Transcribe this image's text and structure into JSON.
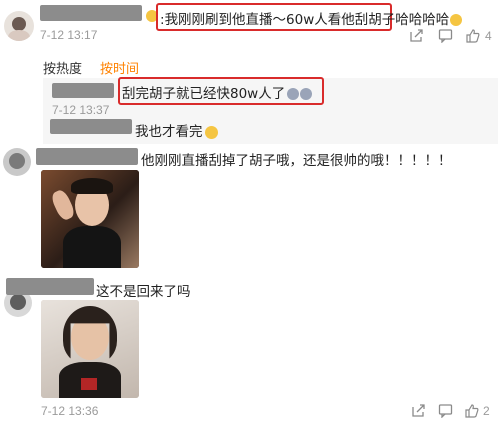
{
  "comment1": {
    "text_prefix": ":",
    "text": "我刚刚刷到他直播～60w人看他刮胡子哈哈哈哈",
    "time": "7-12 13:17",
    "like_count": "4"
  },
  "sort_tabs": {
    "hot": "按热度",
    "time": "按时间"
  },
  "reply1": {
    "text": "刮完胡子就已经快80w人了",
    "time": "7-12 13:37"
  },
  "reply2": {
    "text": "我也才看完"
  },
  "comment2": {
    "text": "他刚刚直播刮掉了胡子哦，还是很帅的哦！！！！！"
  },
  "comment3": {
    "text": "这不是回来了吗",
    "time": "7-12 13:36",
    "like_count": "2"
  },
  "colors": {
    "highlight_border": "#d92b2b",
    "active_tab": "#ff8200",
    "redacted_bar": "#8c8c8c"
  },
  "icons": [
    "share-icon",
    "comment-icon",
    "like-icon",
    "laugh-emoji",
    "sweat-emoji"
  ]
}
